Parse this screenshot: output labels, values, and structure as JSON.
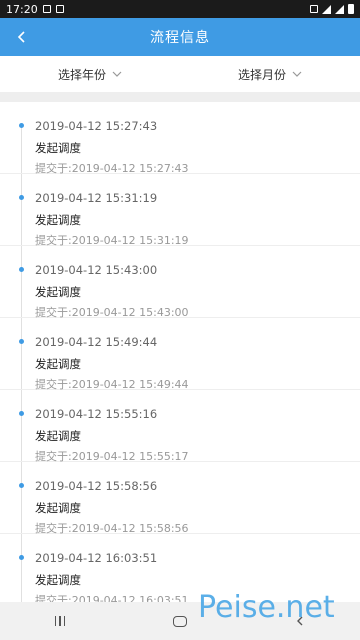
{
  "status_bar": {
    "time": "17:20"
  },
  "app_bar": {
    "title": "流程信息"
  },
  "filters": {
    "year_label": "选择年份",
    "month_label": "选择月份"
  },
  "records": [
    {
      "time": "2019-04-12 15:27:43",
      "action": "发起调度",
      "submitted": "提交于:2019-04-12 15:27:43"
    },
    {
      "time": "2019-04-12 15:31:19",
      "action": "发起调度",
      "submitted": "提交于:2019-04-12 15:31:19"
    },
    {
      "time": "2019-04-12 15:43:00",
      "action": "发起调度",
      "submitted": "提交于:2019-04-12 15:43:00"
    },
    {
      "time": "2019-04-12 15:49:44",
      "action": "发起调度",
      "submitted": "提交于:2019-04-12 15:49:44"
    },
    {
      "time": "2019-04-12 15:55:16",
      "action": "发起调度",
      "submitted": "提交于:2019-04-12 15:55:17"
    },
    {
      "time": "2019-04-12 15:58:56",
      "action": "发起调度",
      "submitted": "提交于:2019-04-12 15:58:56"
    },
    {
      "time": "2019-04-12 16:03:51",
      "action": "发起调度",
      "submitted": "提交于:2019-04-12 16:03:51"
    }
  ],
  "watermark": "Peise.net",
  "colors": {
    "accent": "#3f9be4",
    "status_bar": "#1b1b1b"
  },
  "icons": {
    "back": "chevron-left-icon",
    "dropdown": "chevron-down-icon"
  }
}
